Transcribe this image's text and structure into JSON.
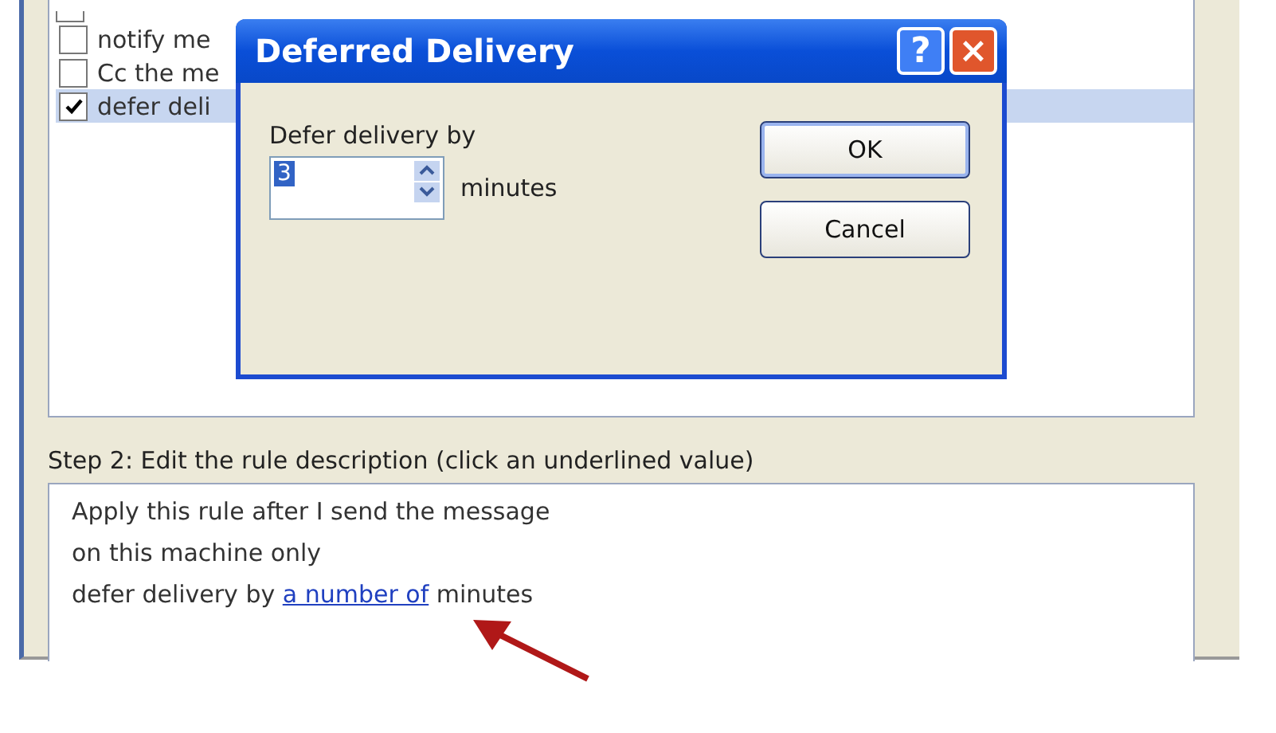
{
  "rules_list": {
    "partial_row": {
      "checked": false
    },
    "items": [
      {
        "label": "notify me",
        "checked": false,
        "selected": false
      },
      {
        "label": "Cc the me",
        "checked": false,
        "selected": false
      },
      {
        "label": "defer deli",
        "checked": true,
        "selected": true
      }
    ]
  },
  "step2": {
    "label": "Step 2: Edit the rule description (click an underlined value)",
    "lines": [
      {
        "kind": "plain",
        "text": "Apply this rule after I send the message"
      },
      {
        "kind": "plain",
        "text": "on this machine only"
      },
      {
        "kind": "link",
        "before": "defer delivery by ",
        "link": "a number of",
        "after": " minutes"
      }
    ]
  },
  "dialog": {
    "title": "Deferred Delivery",
    "help": "?",
    "close": "×",
    "prompt": "Defer delivery by",
    "value": "3",
    "unit": "minutes",
    "buttons": [
      {
        "label": "OK",
        "default": true
      },
      {
        "label": "Cancel",
        "default": false
      }
    ]
  }
}
